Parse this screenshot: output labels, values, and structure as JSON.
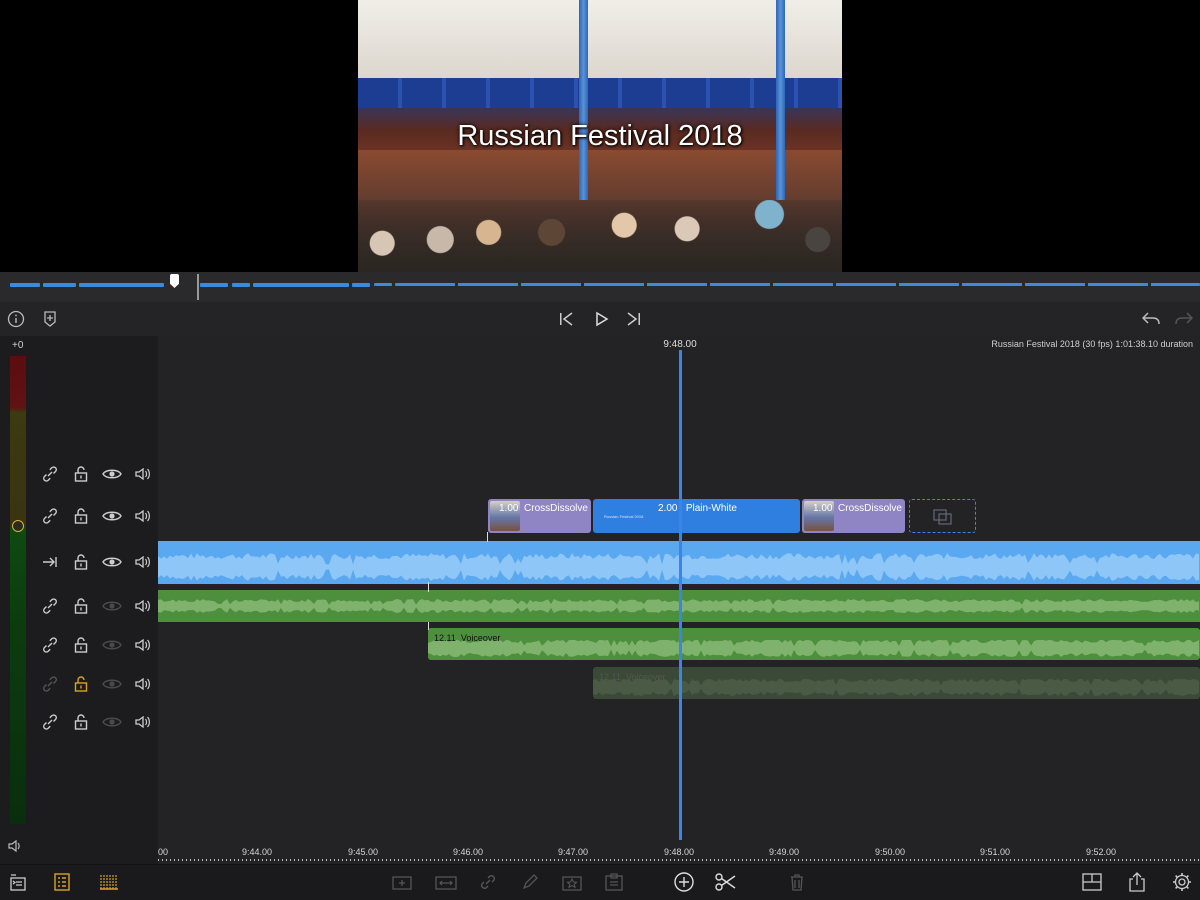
{
  "preview": {
    "title_overlay": "Russian Festival 2018"
  },
  "meter": {
    "level_label": "+0"
  },
  "timeline": {
    "playhead_time": "9:48.00",
    "project_info": "Russian Festival 2018 (30 fps)  1:01:38.10 duration",
    "ruler_ticks": [
      "00",
      "9:44.00",
      "9:45.00",
      "9:46.00",
      "9:47.00",
      "9:48.00",
      "9:49.00",
      "9:50.00",
      "9:51.00",
      "9:52.00"
    ]
  },
  "clips": {
    "transition1": {
      "duration": "1.00",
      "name": "CrossDissolve"
    },
    "title_clip": {
      "duration": "2.00",
      "name": "Plain-White",
      "subtitle": "Russian Festival 2018"
    },
    "transition2": {
      "duration": "1.00",
      "name": "CrossDissolve"
    },
    "voiceover1": {
      "duration": "12.11",
      "name": "Voiceover"
    },
    "voiceover2": {
      "duration": "12.11",
      "name": "Voiceover"
    }
  },
  "colors": {
    "accent": "#3a86e8",
    "video_track": "#5aa8f0",
    "audio_track": "#4e8f3e",
    "transition_clip": "#8f84c4",
    "title_clip": "#2f7fe0",
    "locked": "#d9a325"
  },
  "icons": {
    "transport": [
      "info-icon",
      "add-marker-icon",
      "skip-back-icon",
      "play-icon",
      "skip-forward-icon",
      "undo-icon",
      "redo-icon"
    ],
    "bottom": [
      "project-icon",
      "track-list-icon",
      "ruler-icon",
      "insert-clip-icon",
      "replace-clip-icon",
      "link-icon",
      "pen-icon",
      "favorite-icon",
      "clipboard-icon",
      "add-icon",
      "scissors-icon",
      "trash-icon",
      "layout-icon",
      "share-icon",
      "settings-icon"
    ]
  }
}
